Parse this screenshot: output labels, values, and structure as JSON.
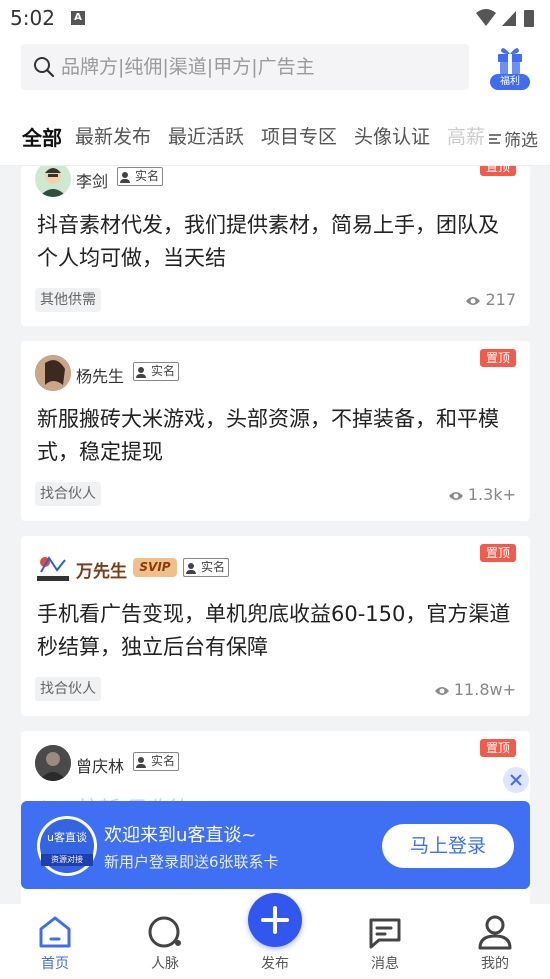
{
  "status_bar": {
    "time": "5:02",
    "notification_letter": "A"
  },
  "search": {
    "placeholder": "品牌方|纯佣|渠道|甲方|广告主"
  },
  "gift": {
    "label": "福利"
  },
  "tabs": [
    {
      "label": "全部",
      "active": true
    },
    {
      "label": "最新发布"
    },
    {
      "label": "最近活跃"
    },
    {
      "label": "项目专区"
    },
    {
      "label": "头像认证"
    },
    {
      "label": "高薪"
    }
  ],
  "filter_label": "筛选",
  "posts": [
    {
      "user": "李剑",
      "verified": "实名",
      "pin": "置顶",
      "title": "抖音素材代发，我们提供素材，简易上手，团队及个人均可做，当天结",
      "tag": "其他供需",
      "views": "217"
    },
    {
      "user": "杨先生",
      "verified": "实名",
      "pin": "置顶",
      "title": "新服搬砖大米游戏，头部资源，不掉装备，和平模式，稳定提现",
      "tag": "找合伙人",
      "views": "1.3k+"
    },
    {
      "user": "万先生",
      "vip": "SVIP",
      "verified": "实名",
      "pin": "置顶",
      "title": "手机看广告变现，单机兜底收益60-150，官方渠道 秒结算，独立后台有保障",
      "tag": "找合伙人",
      "views": "11.8w+"
    },
    {
      "user": "曾庆林",
      "verified": "实名",
      "pin": "置顶",
      "title": "App拉新 只收徒"
    }
  ],
  "banner": {
    "logo_text": "u客直谈",
    "logo_ribbon": "资源对接",
    "headline": "欢迎来到u客直谈~",
    "subline": "新用户登录即送6张联系卡",
    "login_label": "马上登录"
  },
  "bottom_nav": [
    {
      "label": "首页",
      "icon": "home-icon",
      "active": true
    },
    {
      "label": "人脉",
      "icon": "contacts-icon"
    },
    {
      "label": "发布",
      "icon": "plus-icon"
    },
    {
      "label": "消息",
      "icon": "message-icon"
    },
    {
      "label": "我的",
      "icon": "user-icon"
    }
  ],
  "colors": {
    "accent": "#3f6cf0",
    "pin": "#f25a4a",
    "banner": "#3f6ff2"
  }
}
